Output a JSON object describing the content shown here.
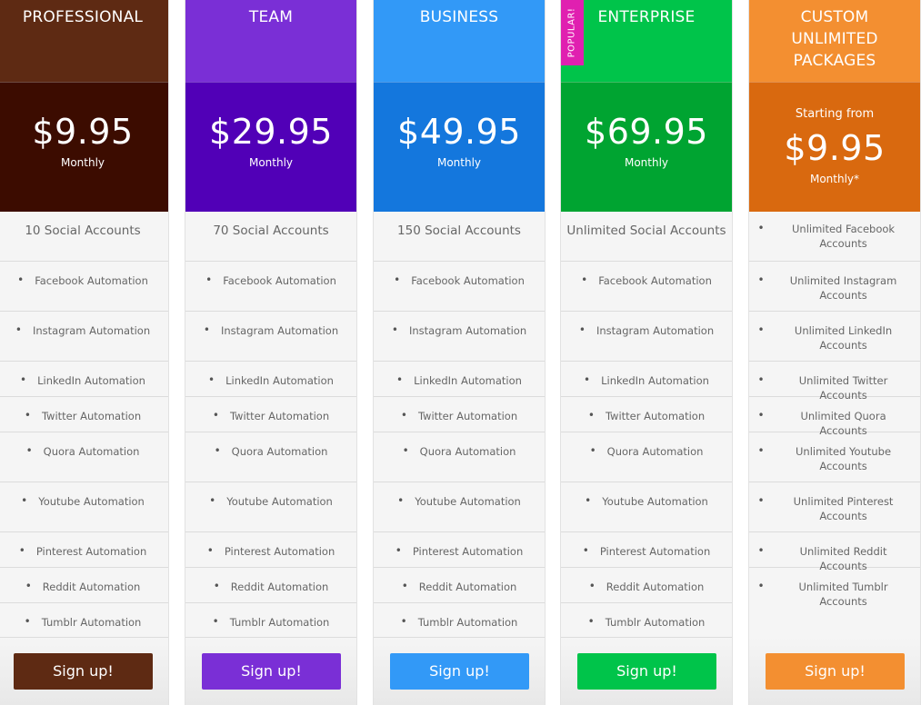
{
  "plans": [
    {
      "name": "PROFESSIONAL",
      "header_color": "#5e2a13",
      "price_color": "#3c0c00",
      "button_color": "#5e2a13",
      "price": "$9.95",
      "period": "Monthly",
      "accounts": "10 Social Accounts",
      "features": [
        "Facebook Automation",
        "Instagram Automation",
        "LinkedIn Automation",
        "Twitter Automation",
        "Quora Automation",
        "Youtube Automation",
        "Pinterest Automation",
        "Reddit Automation",
        "Tumblr Automation"
      ],
      "button": "Sign up!"
    },
    {
      "name": "TEAM",
      "header_color": "#7a2fd6",
      "price_color": "#5100b7",
      "button_color": "#7a2fd6",
      "price": "$29.95",
      "period": "Monthly",
      "accounts": "70 Social Accounts",
      "features": [
        "Facebook Automation",
        "Instagram Automation",
        "LinkedIn Automation",
        "Twitter Automation",
        "Quora Automation",
        "Youtube Automation",
        "Pinterest Automation",
        "Reddit Automation",
        "Tumblr Automation"
      ],
      "button": "Sign up!"
    },
    {
      "name": "BUSINESS",
      "header_color": "#3299f7",
      "price_color": "#1477dd",
      "button_color": "#3299f7",
      "price": "$49.95",
      "period": "Monthly",
      "accounts": "150 Social Accounts",
      "features": [
        "Facebook Automation",
        "Instagram Automation",
        "LinkedIn Automation",
        "Twitter Automation",
        "Quora Automation",
        "Youtube Automation",
        "Pinterest Automation",
        "Reddit Automation",
        "Tumblr Automation"
      ],
      "button": "Sign up!"
    },
    {
      "name": "ENTERPRISE",
      "popular": "POPULAR!",
      "header_color": "#00c44a",
      "price_color": "#00a431",
      "button_color": "#00c44a",
      "price": "$69.95",
      "period": "Monthly",
      "accounts": "Unlimited Social Accounts",
      "features": [
        "Facebook Automation",
        "Instagram Automation",
        "LinkedIn Automation",
        "Twitter Automation",
        "Quora Automation",
        "Youtube Automation",
        "Pinterest Automation",
        "Reddit Automation",
        "Tumblr Automation"
      ],
      "button": "Sign up!"
    },
    {
      "name": "CUSTOM UNLIMITED PACKAGES",
      "header_color": "#f38f31",
      "price_color": "#d9690f",
      "button_color": "#f38f31",
      "start": "Starting from",
      "price": "$9.95",
      "period": "Monthly*",
      "features": [
        "Unlimited Facebook Accounts",
        "Unlimited Instagram Accounts",
        "Unlimited LinkedIn Accounts",
        "Unlimited Twitter Accounts",
        "Unlimited Quora Accounts",
        "Unlimited Youtube Accounts",
        "Unlimited Pinterest Accounts",
        "Unlimited Reddit Accounts",
        "Unlimited Tumblr Accounts"
      ],
      "button": "Sign up!"
    }
  ]
}
